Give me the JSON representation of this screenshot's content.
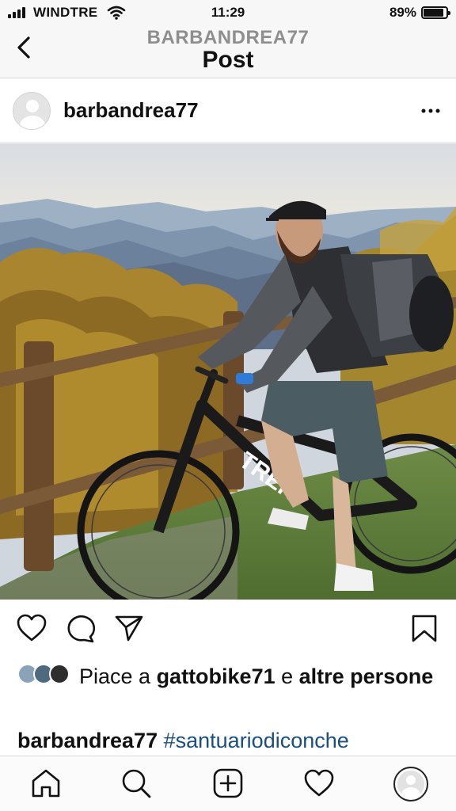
{
  "status_bar": {
    "carrier": "WINDTRE",
    "time": "11:29",
    "battery": "89%",
    "battery_level": 0.89
  },
  "nav": {
    "username": "BARBANDREA77",
    "title": "Post"
  },
  "post": {
    "username": "barbandrea77",
    "photo_description_icon": "photo"
  },
  "likes": {
    "prefix": "Piace a ",
    "user": "gattobike71",
    "conjunction": " e ",
    "others": "altre persone"
  },
  "caption": {
    "username": "barbandrea77",
    "hashtag": "#santuariodiconche"
  },
  "icons": {
    "back": "chevron-left-icon",
    "more": "more-horizontal-icon",
    "like": "heart-icon",
    "comment": "comment-icon",
    "share": "paper-plane-icon",
    "save": "bookmark-icon",
    "home": "home-icon",
    "search": "search-icon",
    "add": "plus-square-icon",
    "activity": "heart-icon",
    "profile": "avatar-icon"
  },
  "colors": {
    "hashtag": "#1a4f82",
    "nav_username": "#8e8e8e"
  }
}
